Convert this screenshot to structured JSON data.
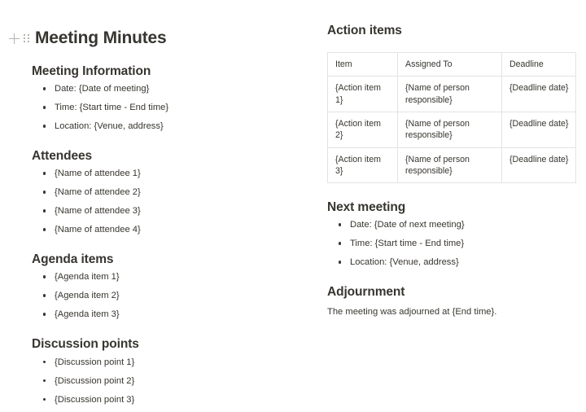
{
  "document": {
    "title": "Meeting Minutes",
    "block_controls": {
      "add_icon": "plus-icon",
      "drag_icon": "drag-handle-icon"
    }
  },
  "left_column": {
    "sections": [
      {
        "heading": "Meeting Information",
        "items": [
          "Date: {Date of meeting}",
          "Time: {Start time - End time}",
          "Location: {Venue, address}"
        ]
      },
      {
        "heading": "Attendees",
        "items": [
          "{Name of attendee 1}",
          "{Name of attendee 2}",
          "{Name of attendee 3}",
          "{Name of attendee 4}"
        ]
      },
      {
        "heading": "Agenda items",
        "items": [
          "{Agenda item 1}",
          "{Agenda item 2}",
          "{Agenda item 3}"
        ]
      },
      {
        "heading": "Discussion points",
        "items": [
          "{Discussion point 1}",
          "{Discussion point 2}",
          "{Discussion point 3}"
        ]
      }
    ]
  },
  "right_column": {
    "action_items": {
      "heading": "Action items",
      "columns": [
        "Item",
        "Assigned To",
        "Deadline"
      ],
      "rows": [
        [
          "{Action item 1}",
          "{Name of person responsible}",
          "{Deadline date}"
        ],
        [
          "{Action item 2}",
          "{Name of person responsible}",
          "{Deadline date}"
        ],
        [
          "{Action item 3}",
          "{Name of person responsible}",
          "{Deadline date}"
        ]
      ]
    },
    "next_meeting": {
      "heading": "Next meeting",
      "items": [
        "Date: {Date of next meeting}",
        "Time: {Start time - End time}",
        "Location: {Venue, address}"
      ]
    },
    "adjournment": {
      "heading": "Adjournment",
      "text": "The meeting was adjourned at {End time}."
    }
  },
  "theme": {
    "background": "#ffffff",
    "text": "#37352f",
    "table_border": "#e5e3e0",
    "control_icon": "#b6b4b0"
  }
}
